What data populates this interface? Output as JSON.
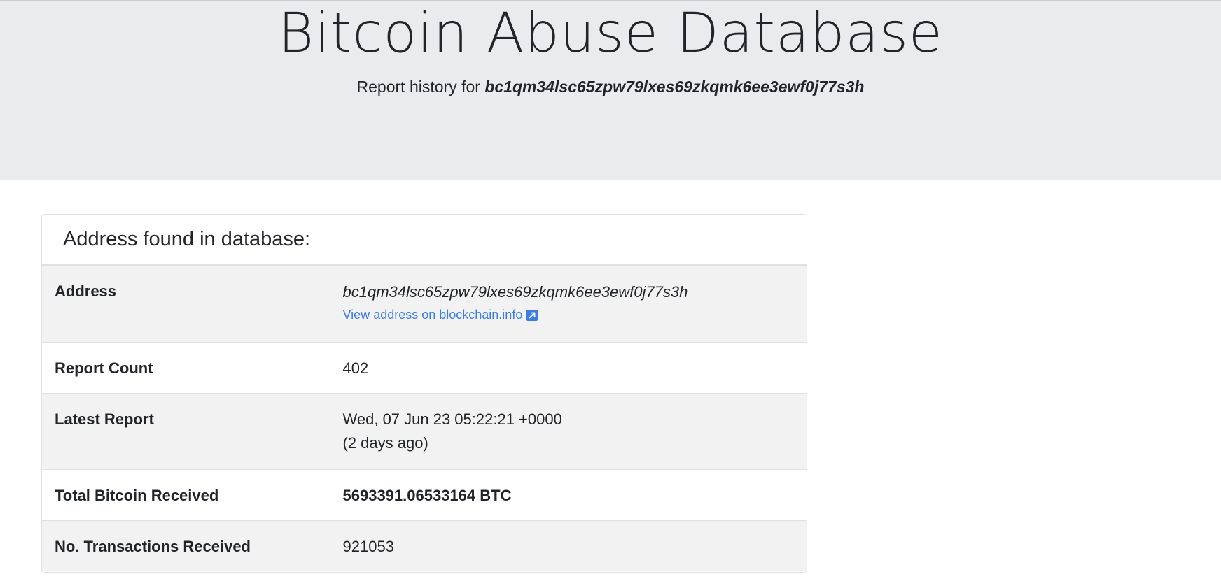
{
  "header": {
    "title": "Bitcoin Abuse Database",
    "subtitle_prefix": "Report history for ",
    "subtitle_address": "bc1qm34lsc65zpw79lxes69zkqmk6ee3ewf0j77s3h"
  },
  "card": {
    "heading": "Address found in database:",
    "rows": {
      "address": {
        "label": "Address",
        "value": "bc1qm34lsc65zpw79lxes69zkqmk6ee3ewf0j77s3h",
        "link_text": "View address on blockchain.info",
        "link_icon": "external-link-icon"
      },
      "report_count": {
        "label": "Report Count",
        "value": "402"
      },
      "latest_report": {
        "label": "Latest Report",
        "value": "Wed, 07 Jun 23 05:22:21 +0000",
        "relative": "(2 days ago)"
      },
      "total_received": {
        "label": "Total Bitcoin Received",
        "value": "5693391.06533164 BTC"
      },
      "tx_received": {
        "label": "No. Transactions Received",
        "value": "921053"
      }
    }
  },
  "colors": {
    "jumbotron_bg": "#e9ecef",
    "link": "#3b7de1",
    "stripe": "#f2f2f2",
    "text": "#212529"
  }
}
